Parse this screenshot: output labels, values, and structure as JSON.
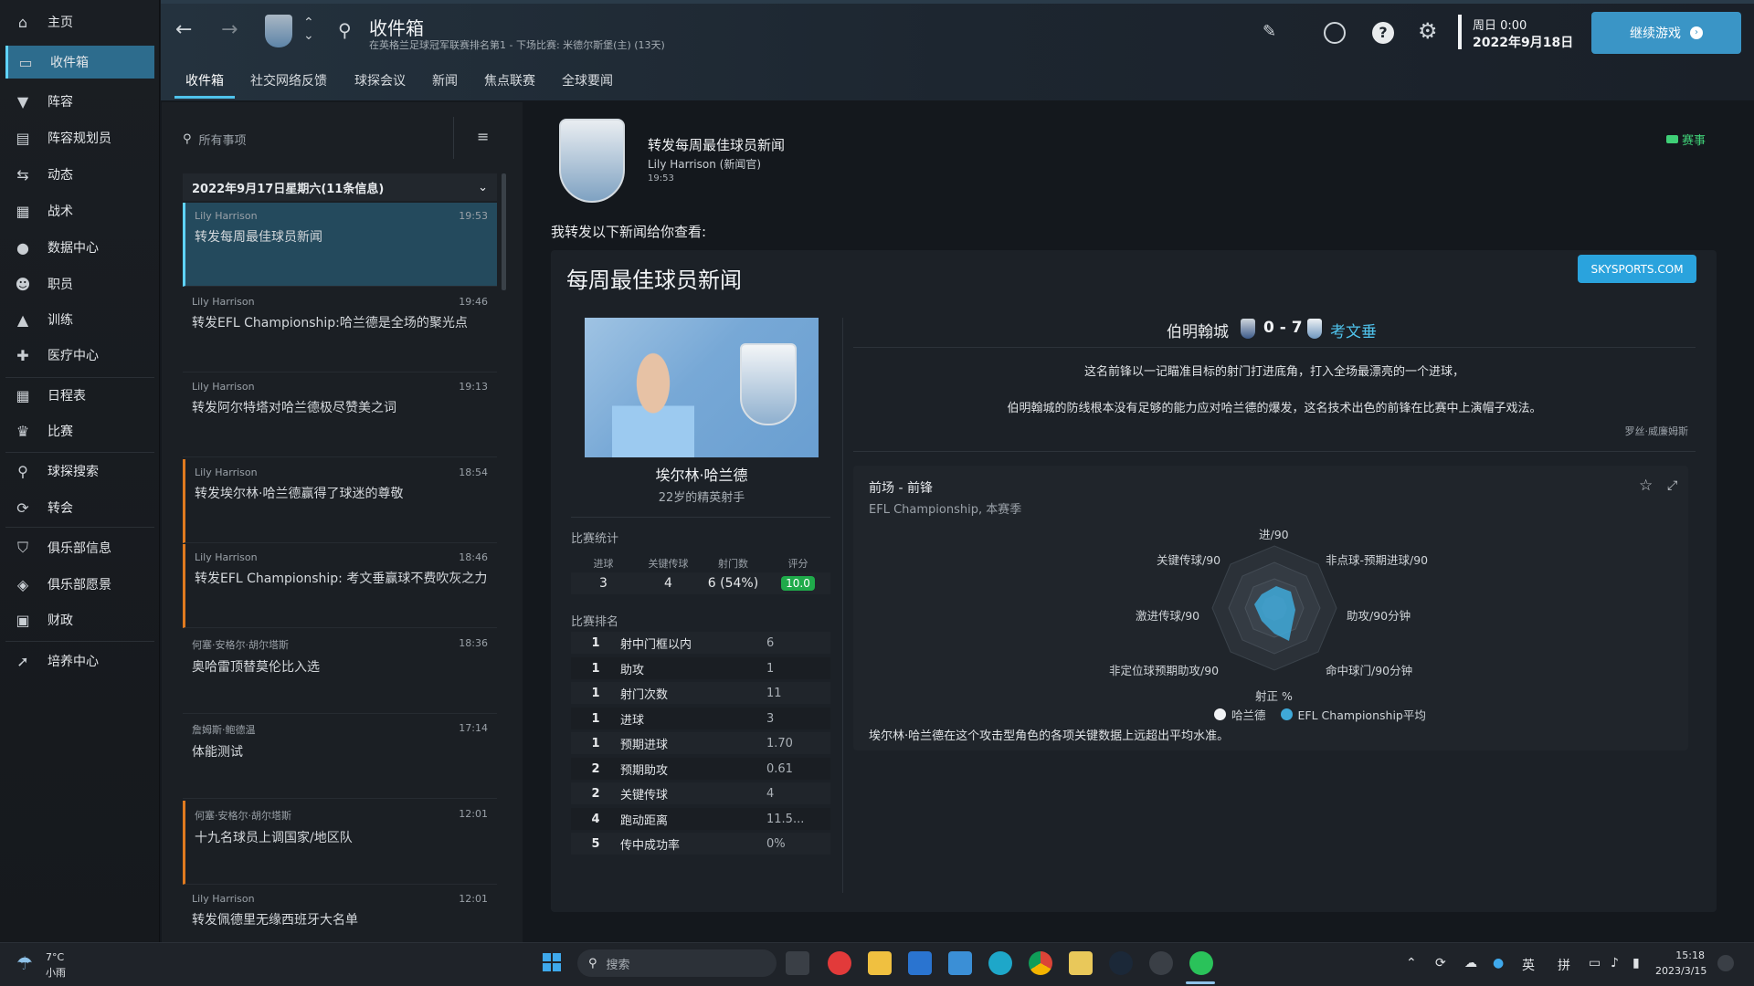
{
  "sidebar": {
    "items": [
      {
        "label": "主页",
        "icon": "home-icon"
      },
      {
        "label": "收件箱",
        "icon": "inbox-icon"
      },
      {
        "label": "阵容",
        "icon": "shirt-icon"
      },
      {
        "label": "阵容规划员",
        "icon": "clipboard-icon"
      },
      {
        "label": "动态",
        "icon": "dynamics-icon"
      },
      {
        "label": "战术",
        "icon": "tactics-icon"
      },
      {
        "label": "数据中心",
        "icon": "data-hub-icon"
      },
      {
        "label": "职员",
        "icon": "staff-icon"
      },
      {
        "label": "训练",
        "icon": "training-cone-icon"
      },
      {
        "label": "医疗中心",
        "icon": "medical-icon"
      },
      {
        "label": "日程表",
        "icon": "calendar-icon"
      },
      {
        "label": "比赛",
        "icon": "trophy-icon"
      },
      {
        "label": "球探搜索",
        "icon": "search-icon"
      },
      {
        "label": "转会",
        "icon": "transfer-icon"
      },
      {
        "label": "俱乐部信息",
        "icon": "shield-icon"
      },
      {
        "label": "俱乐部愿景",
        "icon": "vision-icon"
      },
      {
        "label": "财政",
        "icon": "finance-icon"
      },
      {
        "label": "培养中心",
        "icon": "development-icon"
      }
    ]
  },
  "header": {
    "title": "收件箱",
    "subtitle": "在英格兰足球冠军联赛排名第1 - 下场比赛: 米德尔斯堡(主) (13天)",
    "day": "周日 0:00",
    "date": "2022年9月18日",
    "continue_label": "继续游戏",
    "tabs": [
      "收件箱",
      "社交网络反馈",
      "球探会议",
      "新闻",
      "焦点联赛",
      "全球要闻"
    ]
  },
  "list": {
    "search_placeholder": "所有事项",
    "group_header": "2022年9月17日星期六(11条信息)",
    "messages": [
      {
        "sender": "Lily Harrison",
        "time": "19:53",
        "subject": "转发每周最佳球员新闻"
      },
      {
        "sender": "Lily Harrison",
        "time": "19:46",
        "subject": "转发EFL Championship:哈兰德是全场的聚光点"
      },
      {
        "sender": "Lily Harrison",
        "time": "19:13",
        "subject": "转发阿尔特塔对哈兰德极尽赞美之词"
      },
      {
        "sender": "Lily Harrison",
        "time": "18:54",
        "subject": "转发埃尔林·哈兰德赢得了球迷的尊敬"
      },
      {
        "sender": "Lily Harrison",
        "time": "18:46",
        "subject": "转发EFL Championship: 考文垂赢球不费吹灰之力"
      },
      {
        "sender": "何塞·安格尔·胡尔塔斯",
        "time": "18:36",
        "subject": "奥哈雷顶替莫伦比入选"
      },
      {
        "sender": "詹姆斯·鲍德温",
        "time": "17:14",
        "subject": "体能测试"
      },
      {
        "sender": "何塞·安格尔·胡尔塔斯",
        "time": "12:01",
        "subject": "十九名球员上调国家/地区队"
      },
      {
        "sender": "Lily Harrison",
        "time": "12:01",
        "subject": "转发佩德里无缘西班牙大名单"
      }
    ]
  },
  "message": {
    "title": "转发每周最佳球员新闻",
    "from": "Lily Harrison (新闻官)",
    "time": "19:53",
    "tag": "赛事",
    "intro": "我转发以下新闻给你查看:",
    "news_title": "每周最佳球员新闻",
    "source": "SKYSPORTS.COM",
    "player_name": "埃尔林·哈兰德",
    "player_desc": "22岁的精英射手",
    "match_home": "伯明翰城",
    "match_score": "0 - 7",
    "match_away": "考文垂",
    "quote1": "这名前锋以一记瞄准目标的射门打进底角，打入全场最漂亮的一个进球，",
    "quote2": "伯明翰城的防线根本没有足够的能力应对哈兰德的爆发，这名技术出色的前锋在比赛中上演帽子戏法。",
    "quote_author": "罗丝·威廉姆斯",
    "stats_title": "比赛统计",
    "stats_headers": [
      "进球",
      "关键传球",
      "射门数",
      "评分"
    ],
    "stats_values": [
      "3",
      "4",
      "6 (54%)",
      "10.0"
    ],
    "rank_title": "比赛排名",
    "ranks": [
      {
        "rank": "1",
        "name": "射中门框以内",
        "value": "6"
      },
      {
        "rank": "1",
        "name": "助攻",
        "value": "1"
      },
      {
        "rank": "1",
        "name": "射门次数",
        "value": "11"
      },
      {
        "rank": "1",
        "name": "进球",
        "value": "3"
      },
      {
        "rank": "1",
        "name": "预期进球",
        "value": "1.70"
      },
      {
        "rank": "2",
        "name": "预期助攻",
        "value": "0.61"
      },
      {
        "rank": "2",
        "name": "关键传球",
        "value": "4"
      },
      {
        "rank": "4",
        "name": "跑动距离",
        "value": "11.5..."
      },
      {
        "rank": "5",
        "name": "传中成功率",
        "value": "0%"
      }
    ],
    "radar_title": "前场 - 前锋",
    "radar_subtitle": "EFL Championship, 本赛季",
    "radar_labels": [
      "进/90",
      "非点球-预期进球/90",
      "助攻/90分钟",
      "命中球门/90分钟",
      "射正 %",
      "非定位球预期助攻/90",
      "激进传球/90",
      "关键传球/90"
    ],
    "legend_player": "哈兰德",
    "legend_avg": "EFL Championship平均",
    "radar_summary": "埃尔林·哈兰德在这个攻击型角色的各项关键数据上远超出平均水准。"
  },
  "taskbar": {
    "weather_temp": "7°C",
    "weather_desc": "小雨",
    "search_placeholder": "搜索",
    "ime1": "英",
    "ime2": "拼",
    "clock_time": "15:18",
    "clock_date": "2023/3/15"
  },
  "colors": {
    "accent": "#4fc3ec",
    "selected": "#244a5d",
    "unread": "#e07a1f",
    "rating": "#1faa4a",
    "player_radar": "#3fa9d9"
  }
}
